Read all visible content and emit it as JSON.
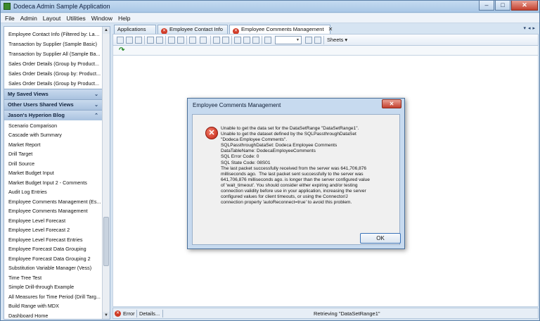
{
  "window": {
    "title": "Dodeca Admin Sample Application",
    "controls": {
      "minimize": "–",
      "maximize": "□",
      "close": "✕"
    }
  },
  "menu": [
    "File",
    "Admin",
    "Layout",
    "Utilities",
    "Window",
    "Help"
  ],
  "sidebar": {
    "top_items": [
      "Employee Contact Info (Filtered by: Las...",
      "Transaction by Supplier (Sample Basic)",
      "Transaction by Supplier All (Sample Ba...",
      "Sales Order Details (Group by Product...",
      "Sales Order Details (Group by: Product...",
      "Sales Order Details (Group by Product..."
    ],
    "sections": [
      "My Saved Views",
      "Other Users Shared Views",
      "Jason's Hyperion Blog"
    ],
    "blog_items": [
      "Scenario Comparison",
      "Cascade with Summary",
      "Market Report",
      "Drill Target",
      "Drill Source",
      "Market Budget Input",
      "Market Budget Input 2 - Comments",
      "Audit Log Entries",
      "Employee Comments Management (Es...",
      "Employee Comments Management",
      "Employee Level Forecast",
      "Employee Level Forecast 2",
      "Employee Level Forecast Entries",
      "Employee Forecast Data Grouping",
      "Employee Forecast Data Grouping 2",
      "Substitution Variable Manager (Vess)",
      "Time Tree Test",
      "Simple Drill-through Example",
      "All Measures for Time Period (Drill Targ...",
      "Build Range with MDX",
      "Dashboard Home"
    ]
  },
  "tabs": [
    {
      "label": "Applications"
    },
    {
      "label": "Employee Contact Info"
    },
    {
      "label": "Employee Comments Management",
      "close": "✕"
    }
  ],
  "toolbar": {
    "sheets_label": "Sheets ▾"
  },
  "status": {
    "error_label": "Error",
    "details_label": "Details...",
    "message": "Retrieving \"DataSetRange1\""
  },
  "dialog": {
    "title": "Employee Comments Management",
    "close": "✕",
    "message": "Unable to get the data set for the DataSetRange \"DataSetRange1\".\nUnable to get the dataset defined by the SQLPassthroughDataSet\n\"Dodeca Employee Comments\".\nSQLPassthroughDataSet: Dodeca Employee Comments\nDataTableName: DodecaEmployeeComments\nSQL Error Code: 0\nSQL State Code: 08S01\nThe last packet successfully received from the server was 641,706,876\nmilliseconds ago.  The last packet sent successfully to the server was\n641,706,876 milliseconds ago. is longer than the server configured value\nof 'wait_timeout'. You should consider either expiring and/or testing\nconnection validity before use in your application, increasing the server\nconfigured values for client timeouts, or using the Connector/J\nconnection property 'autoReconnect=true' to avoid this problem.",
    "ok_label": "OK"
  }
}
